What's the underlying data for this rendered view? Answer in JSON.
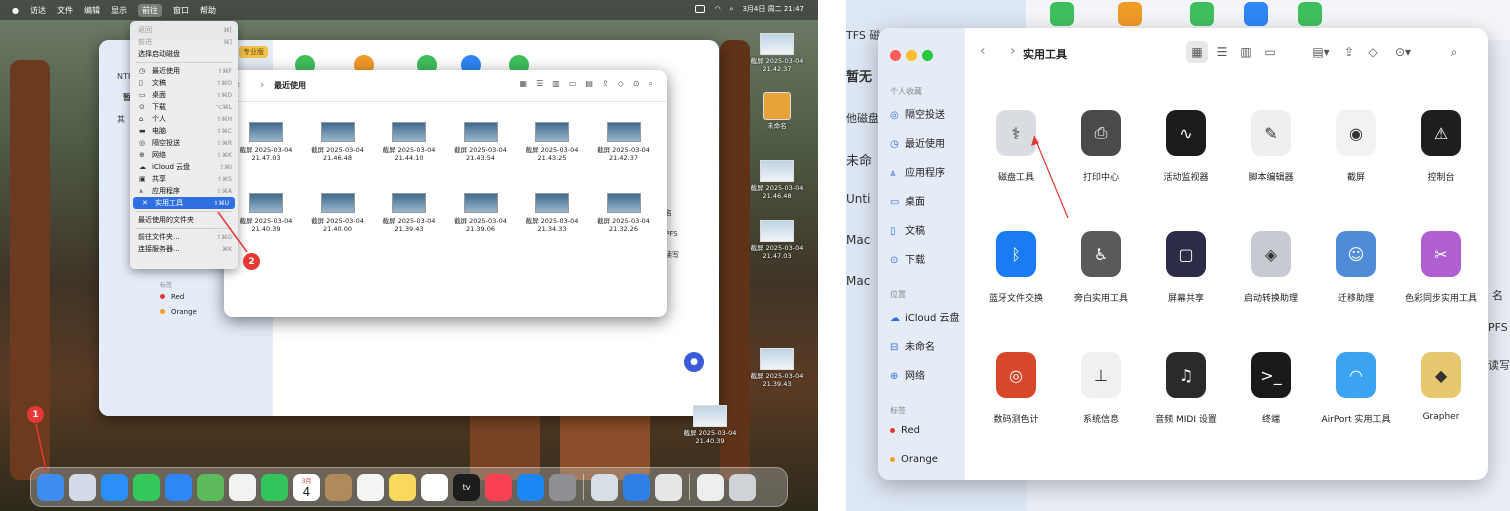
{
  "menubar": {
    "items": [
      "访达",
      "文件",
      "编辑",
      "显示",
      "前往",
      "窗口",
      "帮助"
    ],
    "active": "前往",
    "clock": "3月4日 周二 21:47"
  },
  "go_menu": {
    "items": [
      {
        "label": "返回",
        "shortcut": "⌘[",
        "dim": true
      },
      {
        "label": "前进",
        "shortcut": "⌘]",
        "dim": true
      },
      {
        "label": "选择启动磁盘",
        "shortcut": "",
        "dim": false
      },
      {
        "label": "最近使用",
        "shortcut": "⇧⌘F",
        "icon": "clock-icon",
        "glyph": "◷"
      },
      {
        "label": "文稿",
        "shortcut": "⇧⌘O",
        "icon": "document-icon",
        "glyph": "▯"
      },
      {
        "label": "桌面",
        "shortcut": "⇧⌘D",
        "icon": "desktop-icon",
        "glyph": "▭"
      },
      {
        "label": "下载",
        "shortcut": "⌥⌘L",
        "icon": "download-icon",
        "glyph": "⊙"
      },
      {
        "label": "个人",
        "shortcut": "⇧⌘H",
        "icon": "home-icon",
        "glyph": "⌂"
      },
      {
        "label": "电脑",
        "shortcut": "⇧⌘C",
        "icon": "computer-icon",
        "glyph": "▬"
      },
      {
        "label": "隔空投送",
        "shortcut": "⇧⌘R",
        "icon": "airdrop-icon",
        "glyph": "◎"
      },
      {
        "label": "网络",
        "shortcut": "⇧⌘K",
        "icon": "network-icon",
        "glyph": "⊕"
      },
      {
        "label": "iCloud 云盘",
        "shortcut": "⇧⌘I",
        "icon": "cloud-icon",
        "glyph": "☁"
      },
      {
        "label": "共享",
        "shortcut": "⇧⌘S",
        "icon": "shared-icon",
        "glyph": "▣"
      },
      {
        "label": "应用程序",
        "shortcut": "⇧⌘A",
        "icon": "apps-icon",
        "glyph": "⩓"
      },
      {
        "label": "实用工具",
        "shortcut": "⇧⌘U",
        "icon": "utilities-icon",
        "glyph": "✕",
        "selected": true
      }
    ],
    "recent": "最近使用的文件夹",
    "goto_folder": {
      "label": "前往文件夹...",
      "shortcut": "⇧⌘G"
    },
    "connect": {
      "label": "连接服务器...",
      "shortcut": "⌘K"
    }
  },
  "back_window": {
    "badge": "专业版",
    "sidebar_labels": [
      "NTF",
      "暂",
      "其"
    ],
    "right_labels": [
      "名",
      "PFS",
      "读写"
    ]
  },
  "finder_recent": {
    "title": "最近使用",
    "files": [
      {
        "n1": "截屏 2025-03-04",
        "n2": "21.47.03"
      },
      {
        "n1": "截屏 2025-03-04",
        "n2": "21.46.48"
      },
      {
        "n1": "截屏 2025-03-04",
        "n2": "21.44.10"
      },
      {
        "n1": "截屏 2025-03-04",
        "n2": "21.43.54"
      },
      {
        "n1": "截屏 2025-03-04",
        "n2": "21.43.25"
      },
      {
        "n1": "截屏 2025-03-04",
        "n2": "21.42.37"
      },
      {
        "n1": "截屏 2025-03-04",
        "n2": "21.40.39"
      },
      {
        "n1": "截屏 2025-03-04",
        "n2": "21.40.00"
      },
      {
        "n1": "截屏 2025-03-04",
        "n2": "21.39.43"
      },
      {
        "n1": "截屏 2025-03-04",
        "n2": "21.39.06"
      },
      {
        "n1": "截屏 2025-03-04",
        "n2": "21.34.33"
      },
      {
        "n1": "截屏 2025-03-04",
        "n2": "21.32.26"
      }
    ]
  },
  "tags_small": {
    "header": "标签",
    "items": [
      {
        "name": "Red",
        "color": "#e53935"
      },
      {
        "name": "Orange",
        "color": "#f09a27"
      }
    ]
  },
  "desktop": {
    "items": [
      {
        "n1": "截屏 2025-03-04",
        "n2": "21.42.37"
      },
      {
        "n1": "未命名",
        "n2": ""
      },
      {
        "n1": "截屏 2025-03-04",
        "n2": "21.46.48"
      },
      {
        "n1": "截屏 2025-03-04",
        "n2": "21.47.03"
      },
      {
        "n1": "截屏 2025-03-04",
        "n2": "21.39.43"
      },
      {
        "n1": "截屏 2025-03-04",
        "n2": "21.40.39"
      }
    ]
  },
  "callouts": [
    "1",
    "2"
  ],
  "dock": {
    "apps": [
      {
        "name": "finder-icon",
        "color": "#3d8ef0"
      },
      {
        "name": "launchpad-icon",
        "color": "#d4dbe8"
      },
      {
        "name": "safari-icon",
        "color": "#2a8ff7"
      },
      {
        "name": "messages-icon",
        "color": "#34c759"
      },
      {
        "name": "mail-icon",
        "color": "#2f86f5"
      },
      {
        "name": "maps-icon",
        "color": "#5cba5a"
      },
      {
        "name": "photos-icon",
        "color": "#f2f2f2"
      },
      {
        "name": "facetime-icon",
        "color": "#32c45a"
      },
      {
        "name": "calendar-icon",
        "color": "#ffffff"
      },
      {
        "name": "contacts-icon",
        "color": "#b08a5a"
      },
      {
        "name": "reminders-icon",
        "color": "#f5f5f5"
      },
      {
        "name": "notes-icon",
        "color": "#f8d95b"
      },
      {
        "name": "freeform-icon",
        "color": "#ffffff"
      },
      {
        "name": "tv-icon",
        "color": "#1c1c1e"
      },
      {
        "name": "music-icon",
        "color": "#f94152"
      },
      {
        "name": "appstore-icon",
        "color": "#1d86f5"
      },
      {
        "name": "settings-icon",
        "color": "#8e8e93"
      },
      {
        "name": "preview-icon",
        "color": "#d8dee6"
      },
      {
        "name": "ntfs-icon",
        "color": "#2f7fe8"
      },
      {
        "name": "diskutility-icon",
        "color": "#e6e6e6"
      },
      {
        "name": "doc-icon",
        "color": "#eeeeee"
      },
      {
        "name": "trash-icon",
        "color": "#cfd3d8"
      }
    ],
    "calendar_month": "3月",
    "calendar_day": "4",
    "tv_label": "tv"
  },
  "right_window": {
    "title": "实用工具",
    "bg_labels": [
      "TFS 磁盘",
      "暂无",
      "他磁盘",
      "未命",
      "Unti",
      "Mac",
      "Mac",
      "名",
      "PFS",
      "读写"
    ],
    "sidebar": {
      "sections": [
        {
          "header": "个人收藏",
          "items": [
            {
              "label": "隔空投送",
              "icon": "airdrop-icon",
              "glyph": "◎"
            },
            {
              "label": "最近使用",
              "icon": "clock-icon",
              "glyph": "◷"
            },
            {
              "label": "应用程序",
              "icon": "apps-icon",
              "glyph": "⩓"
            },
            {
              "label": "桌面",
              "icon": "desktop-icon",
              "glyph": "▭"
            },
            {
              "label": "文稿",
              "icon": "document-icon",
              "glyph": "▯"
            },
            {
              "label": "下载",
              "icon": "download-icon",
              "glyph": "⊙"
            }
          ]
        },
        {
          "header": "位置",
          "items": [
            {
              "label": "iCloud 云盘",
              "icon": "cloud-icon",
              "glyph": "☁"
            },
            {
              "label": "未命名",
              "icon": "disk-icon",
              "glyph": "⊟"
            },
            {
              "label": "网络",
              "icon": "network-icon",
              "glyph": "⊕"
            }
          ]
        },
        {
          "header": "标签",
          "items": [
            {
              "label": "Red",
              "icon": "red-tag-icon",
              "color": "#e53935"
            },
            {
              "label": "Orange",
              "icon": "orange-tag-icon",
              "color": "#f09a27"
            }
          ]
        }
      ]
    },
    "apps": [
      {
        "label": "磁盘工具",
        "icon": "disk-utility-icon",
        "color": "#d9dde2",
        "glyph": "⚕"
      },
      {
        "label": "打印中心",
        "icon": "printer-icon",
        "color": "#4a4a4a",
        "glyph": "⎙"
      },
      {
        "label": "活动监视器",
        "icon": "activity-monitor-icon",
        "color": "#1c1c1c",
        "glyph": "∿"
      },
      {
        "label": "脚本编辑器",
        "icon": "script-editor-icon",
        "color": "#efefef",
        "glyph": "✎"
      },
      {
        "label": "截屏",
        "icon": "screenshot-icon",
        "color": "#f2f2f2",
        "glyph": "◉"
      },
      {
        "label": "控制台",
        "icon": "console-icon",
        "color": "#1e1e1e",
        "glyph": "⚠"
      },
      {
        "label": "蓝牙文件交换",
        "icon": "bluetooth-icon",
        "color": "#1a7cf2",
        "glyph": "ᛒ"
      },
      {
        "label": "旁白实用工具",
        "icon": "voiceover-icon",
        "color": "#5a5a5a",
        "glyph": "♿"
      },
      {
        "label": "屏幕共享",
        "icon": "screen-sharing-icon",
        "color": "#2c2c48",
        "glyph": "▢"
      },
      {
        "label": "启动转换助理",
        "icon": "bootcamp-icon",
        "color": "#c8ccd2",
        "glyph": "◈"
      },
      {
        "label": "迁移助理",
        "icon": "migration-icon",
        "color": "#4f8cd8",
        "glyph": "☺"
      },
      {
        "label": "色彩同步实用工具",
        "icon": "colorsync-icon",
        "color": "#b05fd0",
        "glyph": "✂"
      },
      {
        "label": "数码测色计",
        "icon": "color-meter-icon",
        "color": "#d9472b",
        "glyph": "◎"
      },
      {
        "label": "系统信息",
        "icon": "system-info-icon",
        "color": "#f0f0f0",
        "glyph": "⊥"
      },
      {
        "label": "音频 MIDI 设置",
        "icon": "midi-icon",
        "color": "#2a2a2a",
        "glyph": "♫"
      },
      {
        "label": "终端",
        "icon": "terminal-icon",
        "color": "#1a1a1a",
        "glyph": ">_"
      },
      {
        "label": "AirPort 实用工具",
        "icon": "airport-icon",
        "color": "#3aa4f2",
        "glyph": "◠"
      },
      {
        "label": "Grapher",
        "icon": "grapher-icon",
        "color": "#e8c86e",
        "glyph": "◆"
      }
    ],
    "bg_icon_colors": [
      "#3fbf5c",
      "#f09a27",
      "#3fbf5c",
      "#2f86f5",
      "#3fbf5c"
    ]
  }
}
